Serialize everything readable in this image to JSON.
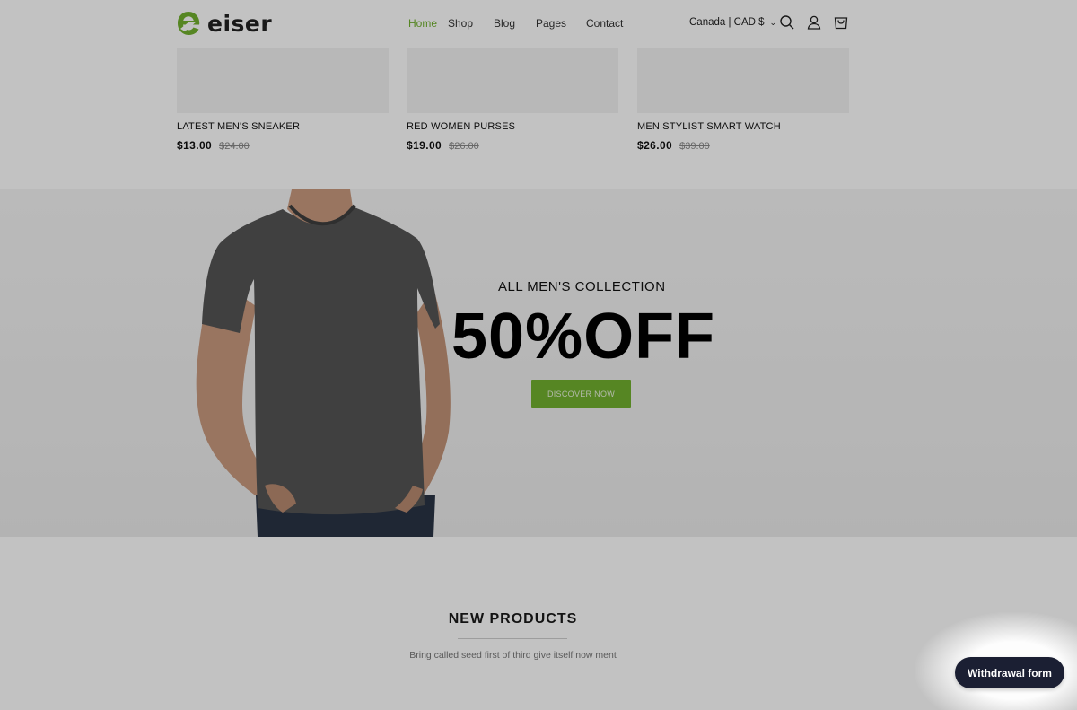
{
  "brand": {
    "name": "eiser",
    "accent_color": "#71b02f"
  },
  "nav": {
    "items": [
      {
        "label": "Home",
        "active": true
      },
      {
        "label": "Shop",
        "active": false
      },
      {
        "label": "Blog",
        "active": false
      },
      {
        "label": "Pages",
        "active": false
      },
      {
        "label": "Contact",
        "active": false
      }
    ]
  },
  "header": {
    "country_selector": "Canada | CAD $",
    "icons": [
      "search-icon",
      "account-icon",
      "cart-icon"
    ]
  },
  "products": [
    {
      "name": "LATEST MEN'S SNEAKER",
      "price": "$13.00",
      "compare_price": "$24.00"
    },
    {
      "name": "RED WOMEN PURSES",
      "price": "$19.00",
      "compare_price": "$26.00"
    },
    {
      "name": "MEN STYLIST SMART WATCH",
      "price": "$26.00",
      "compare_price": "$39.00"
    }
  ],
  "banner": {
    "subtitle": "ALL MEN'S COLLECTION",
    "headline": "50%OFF",
    "button_label": "DISCOVER NOW"
  },
  "new_products": {
    "title": "NEW PRODUCTS",
    "subtitle": "Bring called seed first of third give itself now ment"
  },
  "floating_button": {
    "label": "Withdrawal form"
  }
}
